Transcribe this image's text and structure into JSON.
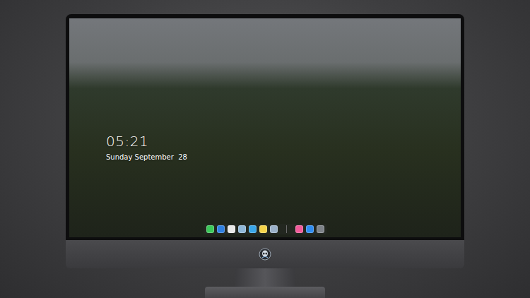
{
  "lock_screen": {
    "time": "05:21",
    "date": "Sunday September  28"
  },
  "dock": {
    "items": [
      {
        "kind": "app",
        "color": "#3cc85a"
      },
      {
        "kind": "app",
        "color": "#2f7fe0"
      },
      {
        "kind": "app",
        "color": "#e8e8e8"
      },
      {
        "kind": "app",
        "color": "#8fb7d8"
      },
      {
        "kind": "app",
        "color": "#3aa6e8"
      },
      {
        "kind": "app",
        "color": "#f4d34a"
      },
      {
        "kind": "app",
        "color": "#9ab0c8"
      },
      {
        "kind": "separator",
        "color": "#6a6a6a"
      },
      {
        "kind": "app",
        "color": "#f25a9a"
      },
      {
        "kind": "app",
        "color": "#2f8cf0"
      },
      {
        "kind": "app",
        "color": "#7d8288"
      }
    ]
  }
}
